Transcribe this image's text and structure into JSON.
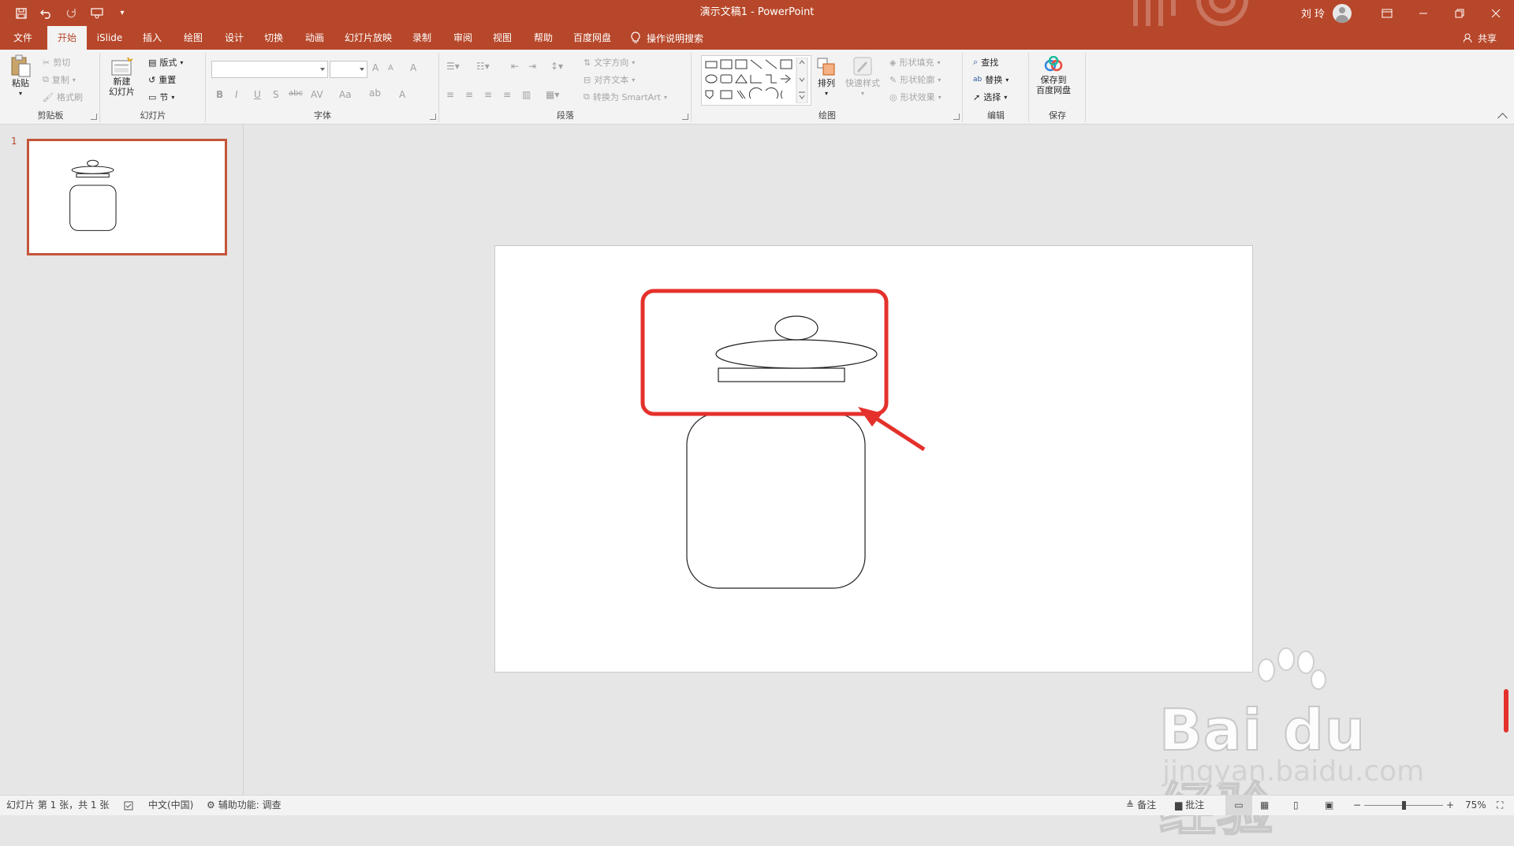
{
  "window": {
    "title": "演示文稿1  -  PowerPoint",
    "user": "刘 玲"
  },
  "quick_access": [
    "save-icon",
    "undo-icon",
    "redo-icon",
    "touch-mode-icon",
    "customize-icon"
  ],
  "tabs": [
    {
      "label": "文件",
      "active": false
    },
    {
      "label": "开始",
      "active": true
    },
    {
      "label": "iSlide",
      "active": false
    },
    {
      "label": "插入",
      "active": false
    },
    {
      "label": "绘图",
      "active": false
    },
    {
      "label": "设计",
      "active": false
    },
    {
      "label": "切换",
      "active": false
    },
    {
      "label": "动画",
      "active": false
    },
    {
      "label": "幻灯片放映",
      "active": false
    },
    {
      "label": "录制",
      "active": false
    },
    {
      "label": "审阅",
      "active": false
    },
    {
      "label": "视图",
      "active": false
    },
    {
      "label": "帮助",
      "active": false
    },
    {
      "label": "百度网盘",
      "active": false
    }
  ],
  "tell_me": "操作说明搜索",
  "share": "共享",
  "ribbon": {
    "clipboard": {
      "label": "剪贴板",
      "paste": "粘贴",
      "cut": "剪切",
      "copy": "复制",
      "format_painter": "格式刷"
    },
    "slides": {
      "label": "幻灯片",
      "new_slide_line1": "新建",
      "new_slide_line2": "幻灯片",
      "layout": "版式",
      "reset": "重置",
      "section": "节"
    },
    "font": {
      "label": "字体",
      "bold": "B",
      "italic": "I",
      "underline": "U",
      "shadow": "S",
      "strike": "abc",
      "spacing": "AV",
      "case": "Aa",
      "grow": "A",
      "shrink": "A",
      "clear": "A",
      "color": "A"
    },
    "paragraph": {
      "label": "段落",
      "text_direction": "文字方向",
      "align_text": "对齐文本",
      "smartart": "转换为 SmartArt"
    },
    "drawing": {
      "label": "绘图",
      "arrange": "排列",
      "quick_styles": "快速样式",
      "shape_fill": "形状填充",
      "shape_outline": "形状轮廓",
      "shape_effects": "形状效果"
    },
    "editing": {
      "label": "编辑",
      "find": "查找",
      "replace": "替换",
      "select": "选择"
    },
    "save": {
      "label": "保存",
      "save_to_line1": "保存到",
      "save_to_line2": "百度网盘"
    }
  },
  "thumbnail": {
    "number": "1"
  },
  "status": {
    "slide_info": "幻灯片 第 1 张，共 1 张",
    "language": "中文(中国)",
    "accessibility": "辅助功能: 调查",
    "notes": "备注",
    "comments": "批注",
    "zoom": "75%",
    "zoom_fraction": 0.5
  },
  "watermark": {
    "text": "Bai du 经验",
    "sub": "jingyan.baidu.com"
  },
  "colors": {
    "accent": "#b7472a",
    "highlight": "#e4312b"
  }
}
